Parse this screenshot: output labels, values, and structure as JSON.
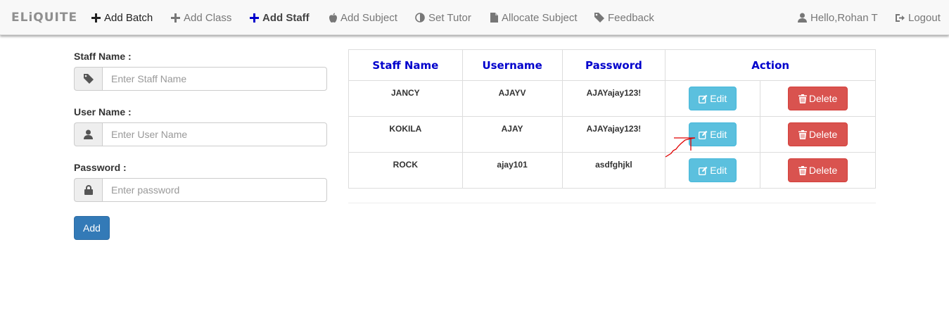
{
  "brand": "ELiQUITE",
  "nav": {
    "add_batch": "Add Batch",
    "add_class": "Add Class",
    "add_staff": "Add Staff",
    "add_subject": "Add Subject",
    "set_tutor": "Set Tutor",
    "allocate_subject": "Allocate Subject",
    "feedback": "Feedback",
    "user": "Hello,Rohan T",
    "logout": "Logout"
  },
  "form": {
    "staff_name_label": "Staff Name :",
    "staff_name_placeholder": "Enter Staff Name",
    "user_name_label": "User Name :",
    "user_name_placeholder": "Enter User Name",
    "password_label": "Password :",
    "password_placeholder": "Enter password",
    "add_label": "Add"
  },
  "table": {
    "headers": {
      "staff_name": "Staff Name",
      "username": "Username",
      "password": "Password",
      "action": "Action"
    },
    "rows": [
      {
        "staff_name": "JANCY",
        "username": "AJAYV",
        "password": "AJAYajay123!"
      },
      {
        "staff_name": "KOKILA",
        "username": "AJAY",
        "password": "AJAYajay123!"
      },
      {
        "staff_name": "ROCK",
        "username": "ajay101",
        "password": "asdfghjkl"
      }
    ],
    "edit_label": "Edit",
    "delete_label": "Delete"
  },
  "colors": {
    "primary": "#337ab7",
    "info": "#5bc0de",
    "danger": "#d9534f",
    "header_text": "#0000cc",
    "annotation": "#e00000"
  }
}
